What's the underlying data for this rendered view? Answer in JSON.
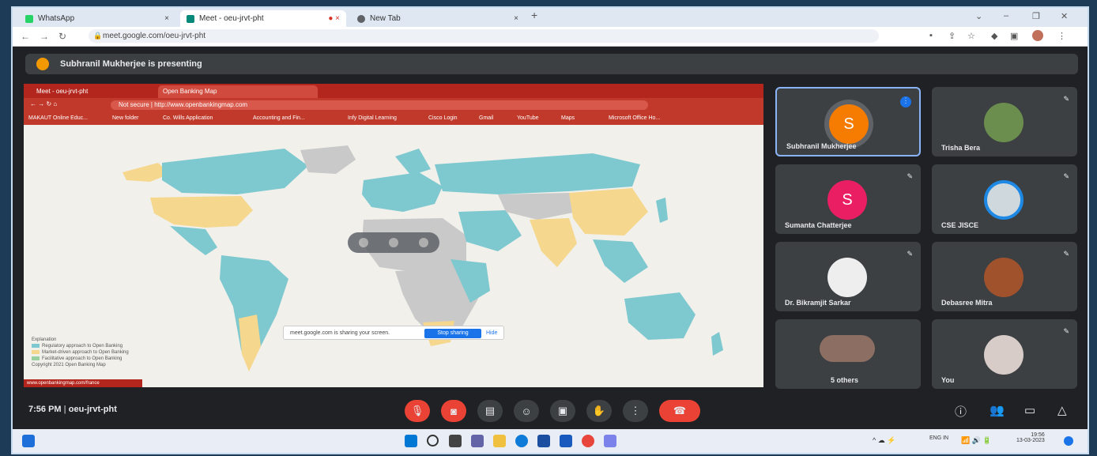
{
  "browser": {
    "tabs": [
      {
        "label": "WhatsApp",
        "color": "#25d366"
      },
      {
        "label": "Meet - oeu-jrvt-pht",
        "color": "#00897b"
      },
      {
        "label": "New Tab",
        "color": "#5f6368"
      }
    ],
    "url": "meet.google.com/oeu-jrvt-pht"
  },
  "meet": {
    "presenting_banner": "Subhranil Mukherjee is presenting",
    "meeting_time": "7:56 PM",
    "meeting_code": "oeu-jrvt-pht",
    "participants": [
      {
        "name": "Subhranil Mukherjee",
        "initial": "S",
        "color": "#f57c00",
        "speaking": true
      },
      {
        "name": "Trisha Bera",
        "initial": "",
        "color": "#6b8e4e"
      },
      {
        "name": "Sumanta Chatterjee",
        "initial": "S",
        "color": "#e91e63"
      },
      {
        "name": "CSE JISCE",
        "initial": "",
        "color": "#cfd8dc"
      },
      {
        "name": "Dr. Bikramjit Sarkar",
        "initial": "",
        "color": "#eeeeee"
      },
      {
        "name": "Debasree Mitra",
        "initial": "",
        "color": "#a0522d"
      },
      {
        "name": "5 others",
        "initial": "",
        "color": "#8d6e63"
      },
      {
        "name": "You",
        "initial": "",
        "color": "#d7ccc8"
      }
    ]
  },
  "shared_screen": {
    "tabs": [
      "Meet - oeu-jrvt-pht",
      "Open Banking Map"
    ],
    "url": "Not secure | http://www.openbankingmap.com",
    "bookmarks": [
      "MAKAUT Online Educ...",
      "New folder",
      "Co. Wills Application",
      "Accounting and Fin...",
      "Infy Digital Learning",
      "Cisco Login",
      "Gmail",
      "YouTube",
      "Maps",
      "Microsoft Office Ho..."
    ],
    "share_notice": "meet.google.com is sharing your screen.",
    "stop_sharing": "Stop sharing",
    "hide": "Hide",
    "legend": {
      "title": "Explanation",
      "items": [
        "Regulatory approach to Open Banking",
        "Market-driven approach to Open Banking",
        "Facilitative approach to Open Banking"
      ],
      "note": "Copyright 2021 Open Banking Map"
    },
    "status_url": "www.openbankingmap.com/france"
  },
  "colors": {
    "regulatory": "#7ec8cf",
    "market": "#f5d78e",
    "none": "#c9c9c9",
    "ocean": "#f1f0eb"
  },
  "taskbar": {
    "lang": "ENG IN",
    "time": "19:56",
    "date": "13-03-2023"
  }
}
